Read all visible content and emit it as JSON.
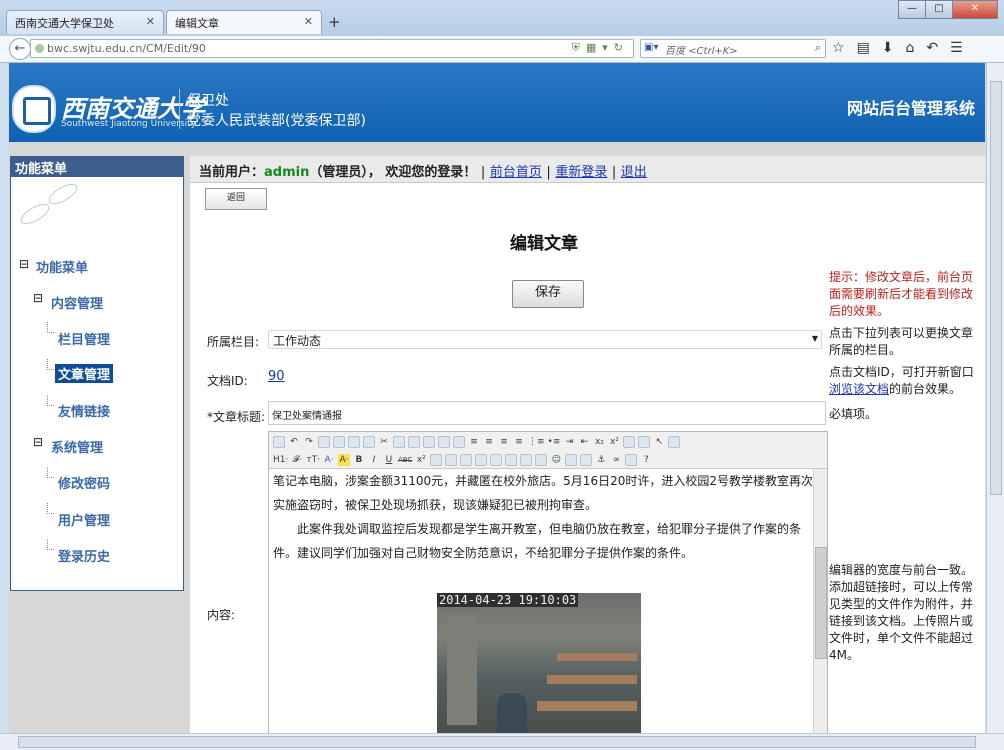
{
  "browser": {
    "tabs": [
      {
        "label": "西南交通大学保卫处"
      },
      {
        "label": "编辑文章"
      }
    ],
    "new_tab": "+",
    "url": "bwc.swjtu.edu.cn/CM/Edit/90",
    "search_placeholder": "百度 <Ctrl+K>",
    "window_buttons": [
      "—",
      "□",
      "✕"
    ]
  },
  "banner": {
    "university_cn": "西南交通大学",
    "university_en": "Southwest Jiaotong University",
    "dept_line1": "保卫处",
    "dept_line2": "党委人民武装部(党委保卫部)",
    "system_title": "网站后台管理系统"
  },
  "sidebar": {
    "header": "功能菜单",
    "items": [
      {
        "label": "功能菜单"
      },
      {
        "label": "内容管理"
      },
      {
        "label": "栏目管理"
      },
      {
        "label": "文章管理"
      },
      {
        "label": "友情链接"
      },
      {
        "label": "系统管理"
      },
      {
        "label": "修改密码"
      },
      {
        "label": "用户管理"
      },
      {
        "label": "登录历史"
      }
    ]
  },
  "userbar": {
    "prefix": "当前用户：",
    "username": "admin",
    "role_welcome": "（管理员）， 欢迎您的登录！",
    "links": [
      "前台首页",
      "重新登录",
      "退出"
    ],
    "separator": "|"
  },
  "form": {
    "back_label": "返回",
    "page_title": "编辑文章",
    "save_label": "保存",
    "category_label": "所属栏目:",
    "category_value": "工作动态",
    "docid_label": "文档ID:",
    "docid_value": "90",
    "title_label": "*文章标题:",
    "title_value": "保卫处案情通报",
    "content_label": "内容:"
  },
  "hints": {
    "save_hint": "提示：修改文章后，前台页面需要刷新后才能看到修改后的效果。",
    "category_hint": "点击下拉列表可以更换文章所属的栏目。",
    "docid_hint_pre": "点击文档ID，可打开新窗口",
    "docid_hint_link": "浏览该文档",
    "docid_hint_post": "的前台效果。",
    "title_hint": "必填项。",
    "editor_hint": "编辑器的宽度与前台一致。添加超链接时，可以上传常见类型的文件作为附件，并链接到该文档。上传照片或文件时，单个文件不能超过4M。"
  },
  "editor": {
    "paragraph1": "笔记本电脑，涉案金额31100元，并藏匿在校外旅店。5月16日20时许，进入校园2号教学楼教室再次实施盗窃时，被保卫处现场抓获，现该嫌疑犯已被刑拘审查。",
    "paragraph2": "此案件我处调取监控后发现都是学生离开教室，但电脑仍放在教室，给犯罪分子提供了作案的条件。建议同学们加强对自己财物安全防范意识，不给犯罪分子提供作案的条件。",
    "image_timestamp": "2014-04-23 19:10:03",
    "toolbar_row2_labels": [
      "H1·",
      "𝓕·",
      "тT·",
      "A·",
      "A·",
      "B",
      "I",
      "U",
      "ABC",
      "x²"
    ]
  }
}
